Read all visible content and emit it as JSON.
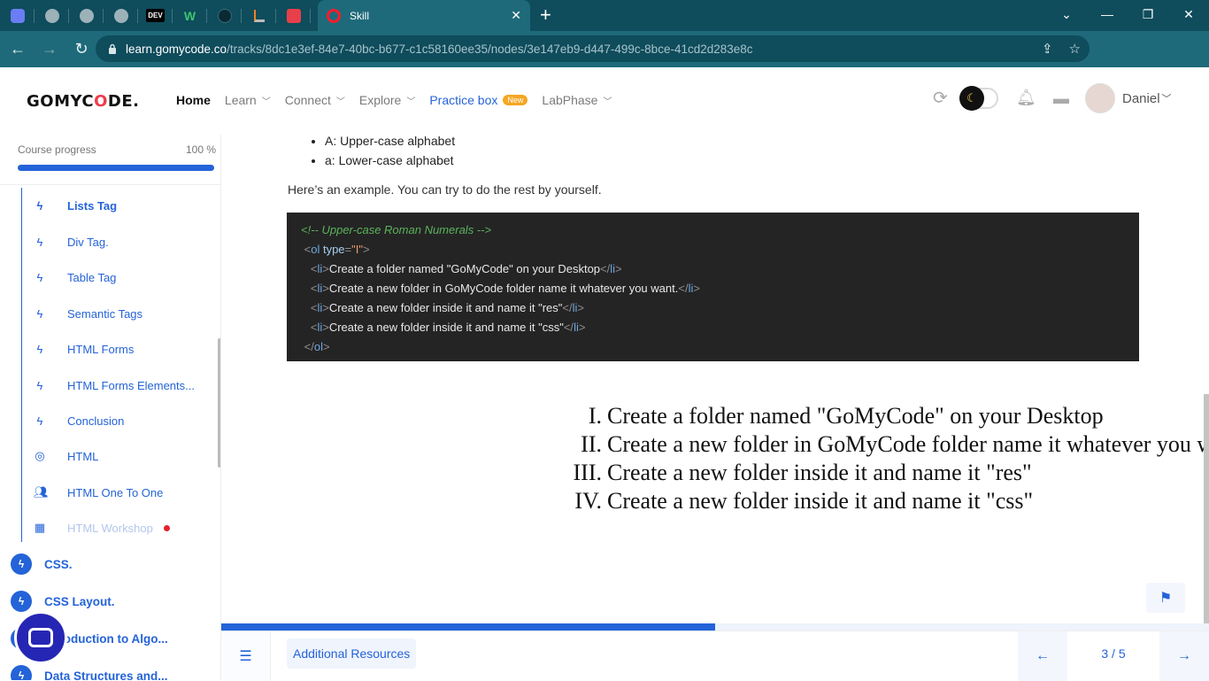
{
  "browser": {
    "tab_title": "Skill",
    "other_tab_icons": [
      "app-icon",
      "globe-icon",
      "globe-icon",
      "globe-icon",
      "dev-icon",
      "w-icon",
      "github-icon",
      "stackoverflow-icon",
      "shield-icon"
    ],
    "dev_label": "DEV",
    "w_label": "W",
    "url_host": "learn.gomycode.co",
    "url_path": "/tracks/8dc1e3ef-84e7-40bc-b677-c1c58160ee35/nodes/3e147eb9-d447-499c-8bce-41cd2d283e8c"
  },
  "header": {
    "logo": {
      "part1": "GOMYC",
      "part2": "O",
      "part3": "DE."
    },
    "nav": [
      {
        "label": "Home",
        "active": true
      },
      {
        "label": "Learn"
      },
      {
        "label": "Connect"
      },
      {
        "label": "Explore"
      },
      {
        "label": "Practice box",
        "badge": "New"
      },
      {
        "label": "LabPhase"
      }
    ],
    "username": "Daniel"
  },
  "sidebar": {
    "progress_label": "Course progress",
    "progress_value": "100 %",
    "progress_fraction": 1.0,
    "items": [
      {
        "label": "Lists Tag",
        "icon": "bolt-icon",
        "bold": true
      },
      {
        "label": "Div Tag.",
        "icon": "bolt-icon"
      },
      {
        "label": "Table Tag",
        "icon": "bolt-icon"
      },
      {
        "label": "Semantic Tags",
        "icon": "bolt-icon"
      },
      {
        "label": "HTML Forms",
        "icon": "bolt-icon"
      },
      {
        "label": "HTML Forms Elements...",
        "icon": "bolt-icon"
      },
      {
        "label": "Conclusion",
        "icon": "bolt-icon"
      },
      {
        "label": "HTML",
        "icon": "target-icon"
      },
      {
        "label": "HTML One To One",
        "icon": "people-icon"
      },
      {
        "label": "HTML Workshop",
        "icon": "workshop-icon",
        "muted": true,
        "dot": true
      }
    ],
    "sections": [
      {
        "label": "CSS."
      },
      {
        "label": "CSS Layout."
      },
      {
        "label": "Introduction to Algo..."
      },
      {
        "label": "Data Structures and..."
      }
    ]
  },
  "content": {
    "bullets": [
      "A: Upper-case alphabet",
      "a: Lower-case alphabet"
    ],
    "intro": "Here’s an example. You can try to do the rest by yourself.",
    "code": {
      "comment": "<!-- Upper-case Roman Numerals -->",
      "ol_open_tag": "ol",
      "ol_attr": "type",
      "ol_attr_value": "\"I\"",
      "li_tag": "li",
      "items": [
        "Create a folder named \"GoMyCode\" on your Desktop",
        "Create a new folder in GoMyCode folder name it whatever you want.",
        "Create a new folder inside it and name it \"res\"",
        "Create a new folder inside it and name it \"css\""
      ]
    },
    "rendered_list": {
      "numerals": [
        "I.",
        "II.",
        "III.",
        "IV."
      ],
      "items": [
        "Create a folder named \"GoMyCode\" on your Desktop",
        "Create a new folder in GoMyCode folder name it whatever you want.",
        "Create a new folder inside it and name it \"res\"",
        "Create a new folder inside it and name it \"css\""
      ]
    }
  },
  "bottom": {
    "resources_label": "Additional Resources",
    "page_indicator": "3 / 5",
    "lesson_progress_fraction": 0.5
  },
  "colors": {
    "accent": "#2463d8",
    "logo_red": "#ef3b4c",
    "badge": "#f6a623",
    "browser_dark": "#0f4c5c",
    "code_bg": "#242424"
  }
}
